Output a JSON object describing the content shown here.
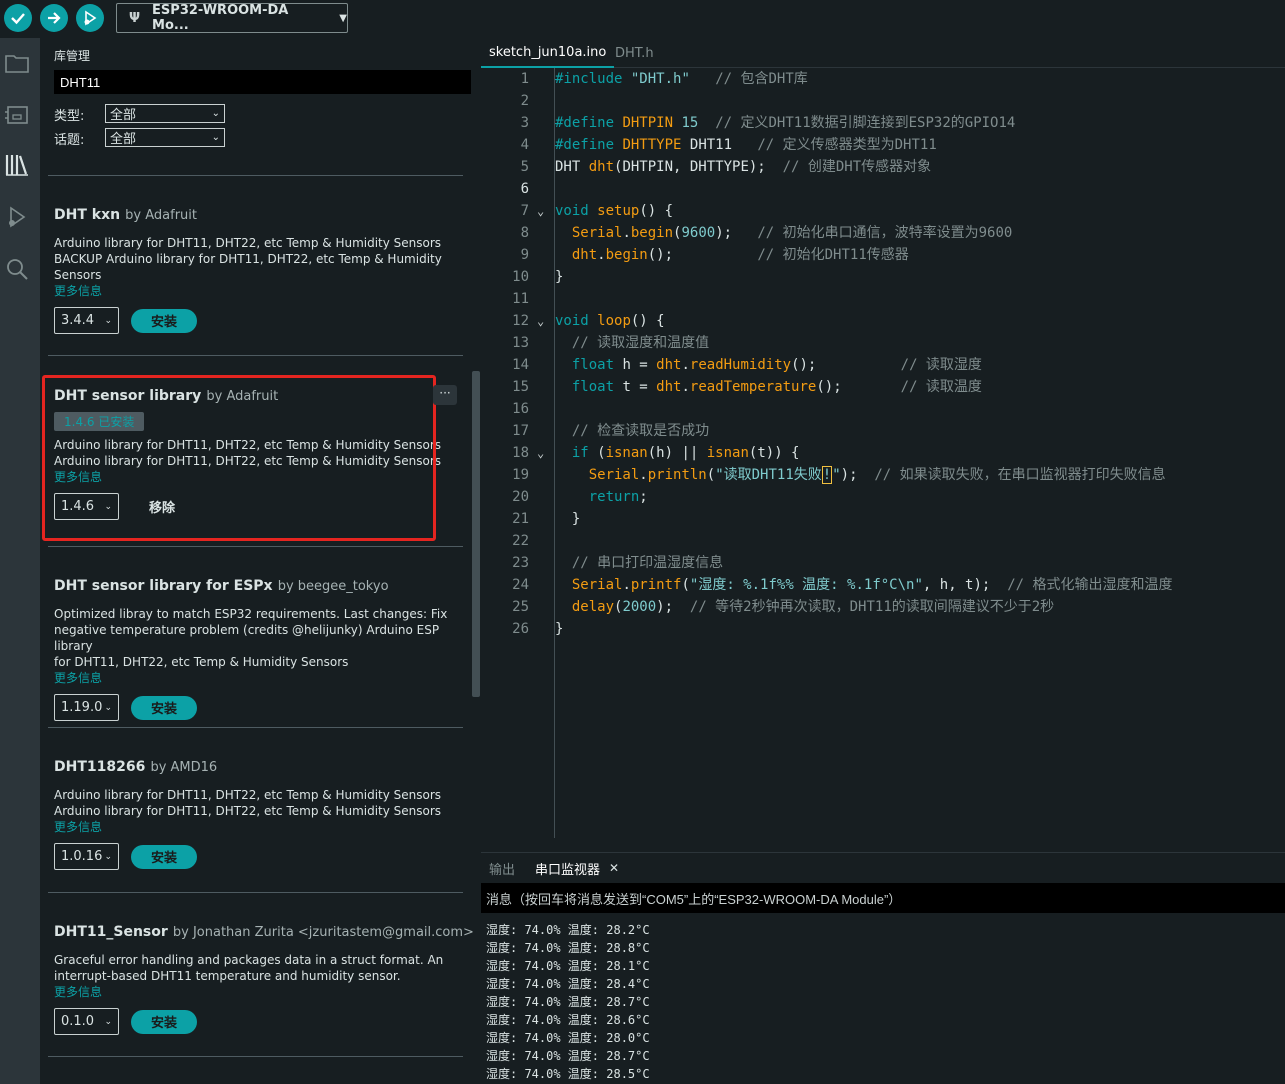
{
  "toolbar": {
    "verify_icon": "check-icon",
    "upload_icon": "arrow-right-icon",
    "debug_icon": "debug-icon",
    "board": "ESP32-WROOM-DA Mo..."
  },
  "activity": [
    "folder-icon",
    "board-icon",
    "library-icon",
    "debug-icon",
    "search-icon"
  ],
  "library": {
    "title": "库管理",
    "search_value": "DHT11",
    "type_label": "类型:",
    "type_value": "全部",
    "topic_label": "话题:",
    "topic_value": "全部",
    "items": [
      {
        "name": "DHT kxn",
        "author": "by Adafruit",
        "desc": [
          "Arduino library for DHT11, DHT22, etc Temp & Humidity Sensors",
          "BACKUP Arduino library for DHT11, DHT22, etc Temp & Humidity",
          "Sensors"
        ],
        "more": "更多信息",
        "version": "3.4.4",
        "action": "安装"
      },
      {
        "name": "DHT sensor library",
        "author": "by Adafruit",
        "installed": "1.4.6 已安装",
        "desc": [
          "Arduino library for DHT11, DHT22, etc Temp & Humidity Sensors",
          "Arduino library for DHT11, DHT22, etc Temp & Humidity Sensors"
        ],
        "more": "更多信息",
        "version": "1.4.6",
        "action": "移除"
      },
      {
        "name": "DHT sensor library for ESPx",
        "author": "by beegee_tokyo",
        "desc": [
          "Optimized libray to match ESP32 requirements. Last changes: Fix",
          "negative temperature problem (credits @helijunky) Arduino ESP library",
          "for DHT11, DHT22, etc Temp & Humidity Sensors"
        ],
        "more": "更多信息",
        "version": "1.19.0",
        "action": "安装"
      },
      {
        "name": "DHT118266",
        "author": "by AMD16",
        "desc": [
          "Arduino library for DHT11, DHT22, etc Temp & Humidity Sensors",
          "Arduino library for DHT11, DHT22, etc Temp & Humidity Sensors"
        ],
        "more": "更多信息",
        "version": "1.0.16",
        "action": "安装"
      },
      {
        "name": "DHT11_Sensor",
        "author": "by Jonathan Zurita <jzuritastem@gmail.com>",
        "desc": [
          "Graceful error handling and packages data in a struct format. An",
          "interrupt-based DHT11 temperature and humidity sensor."
        ],
        "more": "更多信息",
        "version": "0.1.0",
        "action": "安装"
      }
    ],
    "more_menu": "···"
  },
  "editor": {
    "tabs": [
      "sketch_jun10a.ino",
      "DHT.h"
    ],
    "line_numbers": [
      "1",
      "2",
      "3",
      "4",
      "5",
      "6",
      "7",
      "8",
      "9",
      "10",
      "11",
      "12",
      "13",
      "14",
      "15",
      "16",
      "17",
      "18",
      "19",
      "20",
      "21",
      "22",
      "23",
      "24",
      "25",
      "26"
    ]
  },
  "bottom": {
    "tab_output": "输出",
    "tab_serial": "串口监视器",
    "close": "✕",
    "serial_placeholder": "消息（按回车将消息发送到“COM5”上的“ESP32-WROOM-DA Module”）",
    "serial_lines": [
      "湿度: 74.0% 温度: 28.2°C",
      "湿度: 74.0% 温度: 28.8°C",
      "湿度: 74.0% 温度: 28.1°C",
      "湿度: 74.0% 温度: 28.4°C",
      "湿度: 74.0% 温度: 28.7°C",
      "湿度: 74.0% 温度: 28.6°C",
      "湿度: 74.0% 温度: 28.0°C",
      "湿度: 74.0% 温度: 28.7°C",
      "湿度: 74.0% 温度: 28.5°C"
    ]
  },
  "colors": {
    "accent": "#0ca1a6",
    "highlight": "#e52520",
    "background": "#171e21"
  }
}
